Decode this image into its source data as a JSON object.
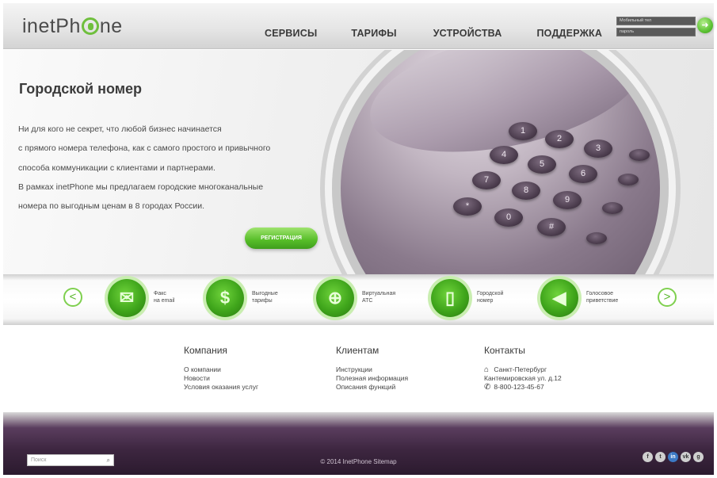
{
  "header": {
    "logo_pre": "inetPh",
    "logo_post": "ne",
    "nav": [
      "СЕРВИСЫ",
      "ТАРИФЫ",
      "УСТРОЙСТВА",
      "ПОДДЕРЖКА"
    ],
    "login": {
      "login_placeholder": "Мобильный тел",
      "password_placeholder": "пароль"
    }
  },
  "hero": {
    "title": "Городской номер",
    "lines": [
      "Ни для кого не секрет, что любой бизнес начинается",
      "с прямого номера телефона, как с самого простого и привычного",
      "способа коммуникации с клиентами и партнерами.",
      "В рамках inetPhone мы предлагаем городские многоканальные",
      "номера по выгодным ценам в 8 городах России."
    ],
    "button": "РЕГИСТРАЦИЯ",
    "keys": [
      "1",
      "2",
      "3",
      "4",
      "5",
      "6",
      "7",
      "8",
      "9",
      "*",
      "0",
      "#"
    ]
  },
  "services": {
    "prev": "<",
    "next": ">",
    "items": [
      {
        "icon": "envelope-icon",
        "glyph": "✉",
        "label_1": "Факс",
        "label_2": "на email"
      },
      {
        "icon": "dollar-icon",
        "glyph": "$",
        "label_1": "Выгодные",
        "label_2": "тарифы"
      },
      {
        "icon": "globe-icon",
        "glyph": "⊕",
        "label_1": "Виртуальная",
        "label_2": "АТС"
      },
      {
        "icon": "mobile-phone-icon",
        "glyph": "▯",
        "label_1": "Городской",
        "label_2": "номер"
      },
      {
        "icon": "megaphone-icon",
        "glyph": "◀",
        "label_1": "Голосовое",
        "label_2": "приветствие"
      }
    ]
  },
  "footer": {
    "company": {
      "title": "Компания",
      "links": [
        "О компании",
        "Новости",
        "Условия оказания услуг"
      ]
    },
    "clients": {
      "title": "Клиентам",
      "links": [
        "Инструкции",
        "Полезная информация",
        "Описания функций"
      ]
    },
    "contacts": {
      "title": "Контакты",
      "city": "Санкт-Петербург",
      "address": "Кантемировская ул. д.12",
      "phone": "8-800-123-45-67"
    },
    "search_placeholder": "Поиск",
    "copyright": "© 2014 InetPhone Sitemap",
    "social": [
      "f",
      "t",
      "in",
      "vk",
      "g"
    ]
  },
  "colors": {
    "accent_green": "#56bd28",
    "footer_purple": "#3d2640"
  }
}
